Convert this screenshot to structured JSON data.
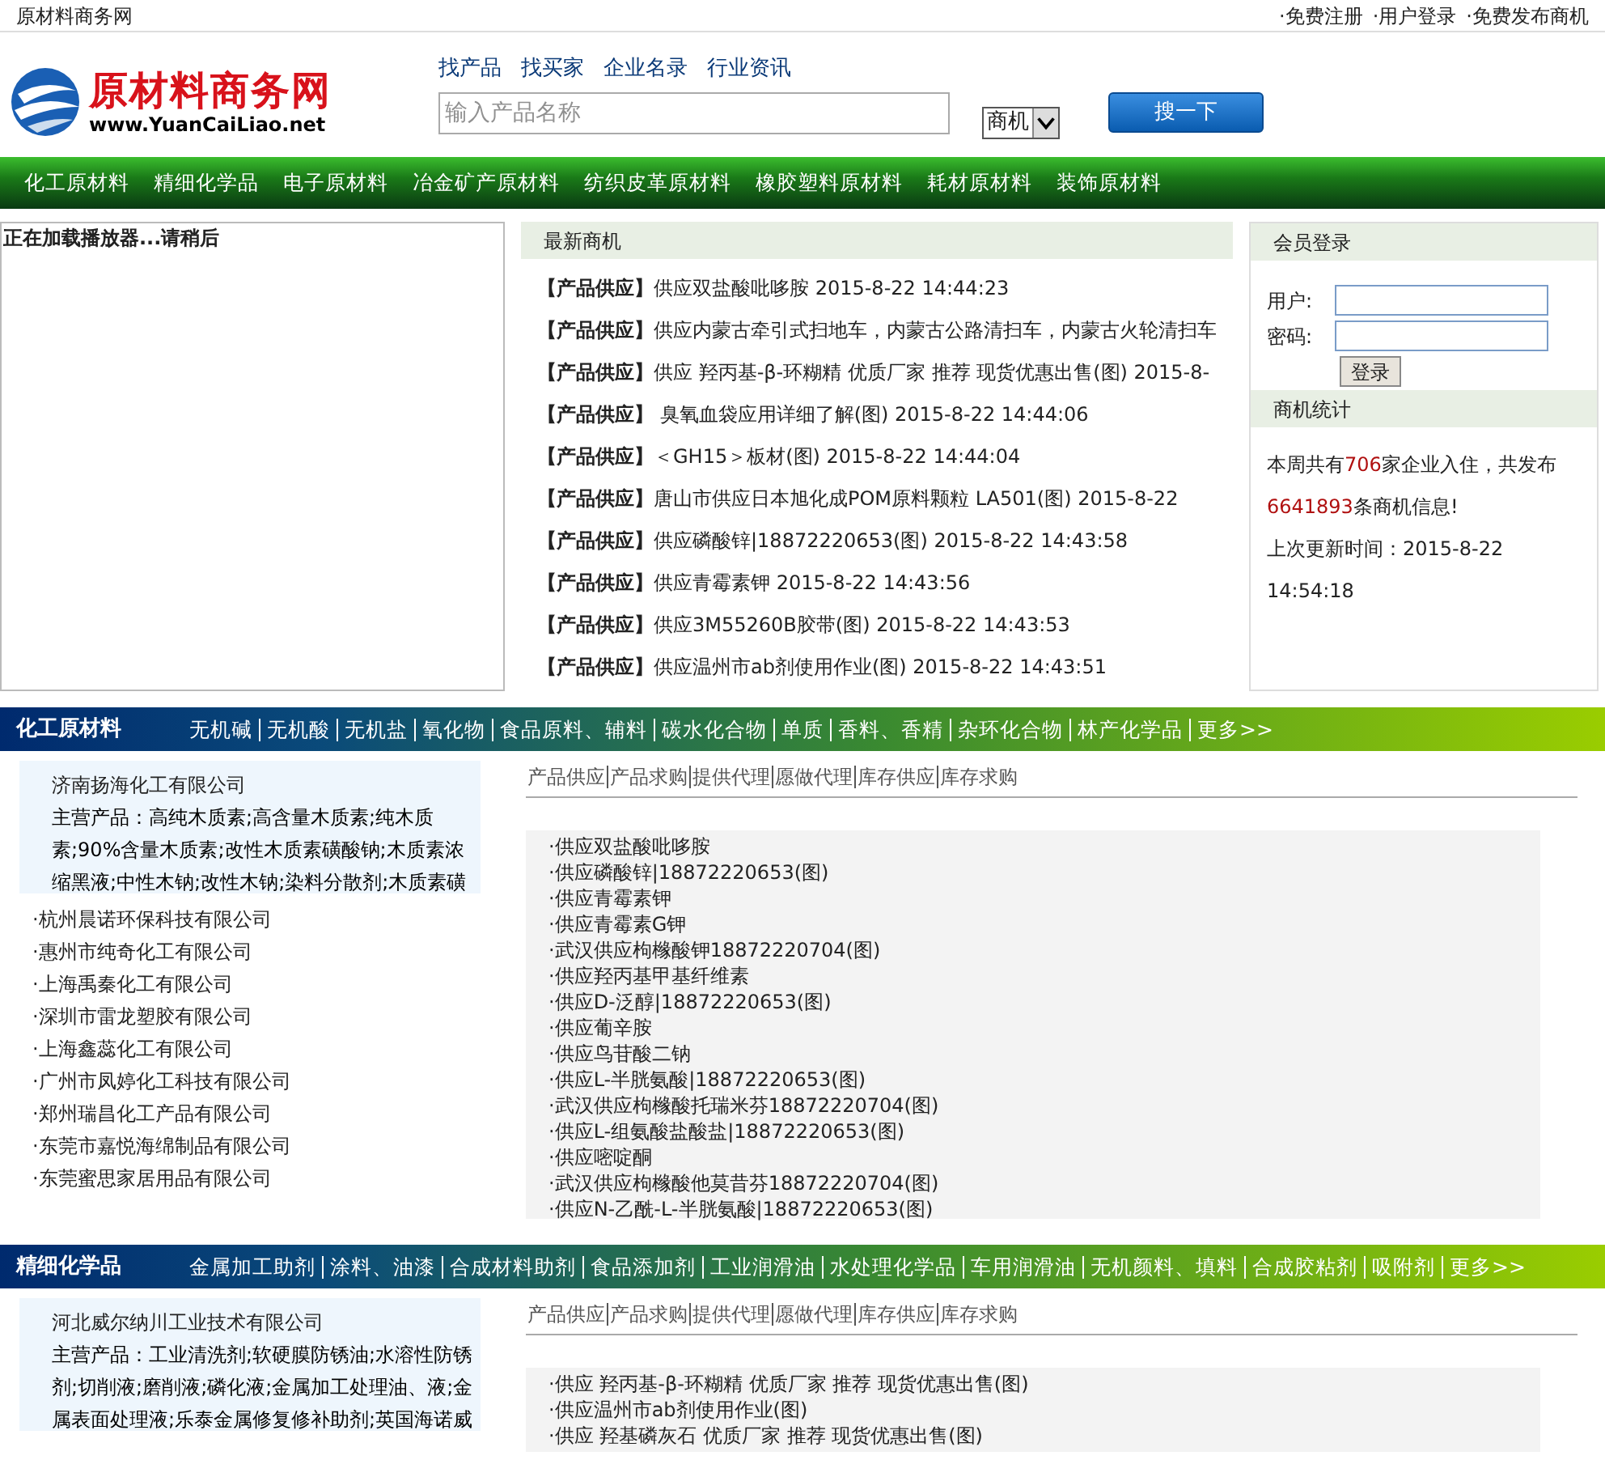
{
  "top_bar": {
    "site_name": "原材料商务网",
    "links": [
      "·免费注册",
      "·用户登录",
      "·免费发布商机"
    ]
  },
  "header": {
    "logo": {
      "title": "原材料商务网",
      "url": "www.YuanCaiLiao.net"
    },
    "nav_links": [
      "找产品",
      "找买家",
      "企业名录",
      "行业资讯"
    ],
    "search": {
      "placeholder": "输入产品名称",
      "select_value": "商机",
      "button": "搜一下"
    }
  },
  "main_nav": [
    "化工原材料",
    "精细化学品",
    "电子原材料",
    "冶金矿产原材料",
    "纺织皮革原材料",
    "橡胶塑料原材料",
    "耗材原材料",
    "装饰原材料"
  ],
  "player": {
    "message": "正在加载播放器...请稍后"
  },
  "latest": {
    "title": "最新商机",
    "items": [
      {
        "tag": "【产品供应】",
        "text": "供应双盐酸吡哆胺  2015-8-22 14:44:23"
      },
      {
        "tag": "【产品供应】",
        "text": "供应内蒙古牵引式扫地车，内蒙古公路清扫车，内蒙古火轮清扫车"
      },
      {
        "tag": "【产品供应】",
        "text": "供应 羟丙基-β-环糊精 优质厂家 推荐 现货优惠出售(图) 2015-8-"
      },
      {
        "tag": "【产品供应】",
        "text": " 臭氧血袋应用详细了解(图) 2015-8-22 14:44:06"
      },
      {
        "tag": "【产品供应】",
        "text": "＜GH15＞板材(图) 2015-8-22 14:44:04"
      },
      {
        "tag": "【产品供应】",
        "text": "唐山市供应日本旭化成POM原料颗粒 LA501(图) 2015-8-22"
      },
      {
        "tag": "【产品供应】",
        "text": "供应磷酸锌|18872220653(图) 2015-8-22 14:43:58"
      },
      {
        "tag": "【产品供应】",
        "text": "供应青霉素钾  2015-8-22 14:43:56"
      },
      {
        "tag": "【产品供应】",
        "text": "供应3M55260B胶带(图) 2015-8-22 14:43:53"
      },
      {
        "tag": "【产品供应】",
        "text": "供应温州市ab剂使用作业(图) 2015-8-22 14:43:51"
      }
    ]
  },
  "member": {
    "title": "会员登录",
    "user_label": "用户:",
    "password_label": "密码:",
    "login_button": "登录"
  },
  "stats": {
    "title": "商机统计",
    "prefix": "本周共有",
    "companies": "706",
    "middle": "家企业入住，共发布",
    "posts": "6641893",
    "suffix": "条商机信息!",
    "update": "上次更新时间：2015-8-22 14:54:18"
  },
  "sections": [
    {
      "title": "化工原材料",
      "categories": [
        "无机碱",
        "无机酸",
        "无机盐",
        "氧化物",
        "食品原料、辅料",
        "碳水化合物",
        "单质",
        "香料、香精",
        "杂环化合物",
        "林产化学品",
        "更多>>"
      ],
      "featured": {
        "company": "济南扬海化工有限公司",
        "description": "主营产品：高纯木质素;高含量木质素;纯木质素;90%含量木质素;改性木质素磺酸钠;木质素浓缩黑液;中性木钠;改性木钠;染料分散剂;木质素磺"
      },
      "companies": [
        "·杭州晨诺环保科技有限公司",
        "·惠州市纯奇化工有限公司",
        "·上海禹秦化工有限公司",
        "·深圳市雷龙塑胶有限公司",
        "·上海鑫蕊化工有限公司",
        "·广州市凤婷化工科技有限公司",
        "·郑州瑞昌化工产品有限公司",
        "·东莞市嘉悦海绵制品有限公司",
        "·东莞蜜思家居用品有限公司"
      ],
      "tabs": [
        "产品供应",
        "产品求购",
        "提供代理",
        "愿做代理",
        "库存供应",
        "库存求购"
      ],
      "products": [
        "·供应双盐酸吡哆胺",
        "·供应磷酸锌|18872220653(图)",
        "·供应青霉素钾",
        "·供应青霉素G钾",
        "·武汉供应枸橼酸钾18872220704(图)",
        "·供应羟丙基甲基纤维素",
        "·供应D-泛醇|18872220653(图)",
        "·供应葡辛胺",
        "·供应鸟苷酸二钠",
        "·供应L-半胱氨酸|18872220653(图)",
        "·武汉供应枸橼酸托瑞米芬18872220704(图)",
        "·供应L-组氨酸盐酸盐|18872220653(图)",
        "·供应嘧啶酮",
        "·武汉供应枸橼酸他莫昔芬18872220704(图)",
        "·供应N-乙酰-L-半胱氨酸|18872220653(图)"
      ]
    },
    {
      "title": "精细化学品",
      "categories": [
        "金属加工助剂",
        "涂料、油漆",
        "合成材料助剂",
        "食品添加剂",
        "工业润滑油",
        "水处理化学品",
        "车用润滑油",
        "无机颜料、填料",
        "合成胶粘剂",
        "吸附剂",
        "更多>>"
      ],
      "featured": {
        "company": "河北威尔纳川工业技术有限公司",
        "description": "主营产品：工业清洗剂;软硬膜防锈油;水溶性防锈剂;切削液;磨削液;磷化液;金属加工处理油、液;金属表面处理液;乐泰金属修复修补助剂;英国海诺威"
      },
      "tabs": [
        "产品供应",
        "产品求购",
        "提供代理",
        "愿做代理",
        "库存供应",
        "库存求购"
      ],
      "products": [
        "·供应 羟丙基-β-环糊精 优质厂家 推荐 现货优惠出售(图)",
        "·供应温州市ab剂使用作业(图)",
        "·供应 羟基磷灰石 优质厂家 推荐 现货优惠出售(图)"
      ]
    }
  ]
}
